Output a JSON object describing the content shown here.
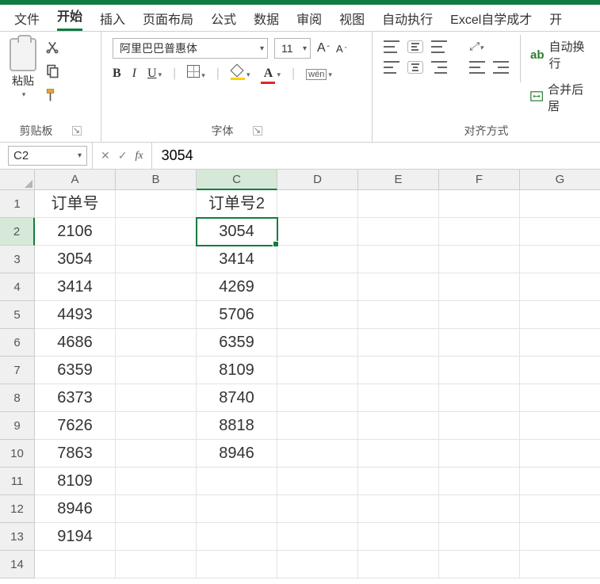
{
  "tabs": {
    "file": "文件",
    "home": "开始",
    "insert": "插入",
    "layout": "页面布局",
    "formulas": "公式",
    "data": "数据",
    "review": "审阅",
    "view": "视图",
    "auto": "自动执行",
    "learn": "Excel自学成才",
    "dev": "开"
  },
  "ribbon": {
    "clipboard": {
      "paste": "粘贴",
      "label": "剪贴板"
    },
    "font": {
      "name": "阿里巴巴普惠体",
      "size": "11",
      "bold": "B",
      "italic": "I",
      "underline": "U",
      "fontcolor_letter": "A",
      "wen": "wén",
      "label": "字体"
    },
    "align": {
      "wrap": "自动换行",
      "merge": "合并后居",
      "label": "对齐方式"
    }
  },
  "formula_bar": {
    "name_box": "C2",
    "cancel": "✕",
    "enter": "✓",
    "fx": "fx",
    "value": "3054"
  },
  "grid": {
    "columns": [
      "A",
      "B",
      "C",
      "D",
      "E",
      "F",
      "G"
    ],
    "selected_col_index": 2,
    "rows": [
      1,
      2,
      3,
      4,
      5,
      6,
      7,
      8,
      9,
      10,
      11,
      12,
      13,
      14
    ],
    "selected_row_index": 1,
    "selected_cell": "C2",
    "data": {
      "A": [
        "订单号",
        "2106",
        "3054",
        "3414",
        "4493",
        "4686",
        "6359",
        "6373",
        "7626",
        "7863",
        "8109",
        "8946",
        "9194",
        ""
      ],
      "B": [
        "",
        "",
        "",
        "",
        "",
        "",
        "",
        "",
        "",
        "",
        "",
        "",
        "",
        ""
      ],
      "C": [
        "订单号2",
        "3054",
        "3414",
        "4269",
        "5706",
        "6359",
        "8109",
        "8740",
        "8818",
        "8946",
        "",
        "",
        "",
        ""
      ],
      "D": [
        "",
        "",
        "",
        "",
        "",
        "",
        "",
        "",
        "",
        "",
        "",
        "",
        "",
        ""
      ],
      "E": [
        "",
        "",
        "",
        "",
        "",
        "",
        "",
        "",
        "",
        "",
        "",
        "",
        "",
        ""
      ],
      "F": [
        "",
        "",
        "",
        "",
        "",
        "",
        "",
        "",
        "",
        "",
        "",
        "",
        "",
        ""
      ],
      "G": [
        "",
        "",
        "",
        "",
        "",
        "",
        "",
        "",
        "",
        "",
        "",
        "",
        "",
        ""
      ]
    }
  }
}
